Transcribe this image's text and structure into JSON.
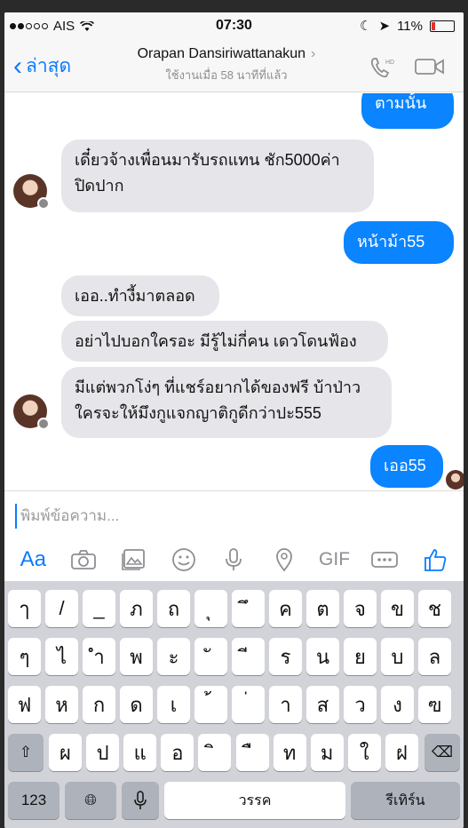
{
  "status": {
    "carrier": "AIS",
    "time": "07:30",
    "battery": "11%",
    "signal_icon": "signal-dots",
    "wifi_icon": "wifi-icon"
  },
  "nav": {
    "back_label": "ล่าสุด",
    "contact_name": "Orapan Dansiriwattanakun",
    "active_status": "ใช้งานเมื่อ 58 นาทีที่แล้ว",
    "call_icon": "phone-hd-icon",
    "video_icon": "video-camera-icon"
  },
  "messages": [
    {
      "direction": "out",
      "text": "ตามนั้น"
    },
    {
      "direction": "in",
      "text": "เดี๋ยวจ้างเพื่อนมารับรถแทน ชัก5000ค่าปิดปาก"
    },
    {
      "direction": "out",
      "text": "หน้าม้า55"
    },
    {
      "direction": "in",
      "text": "เออ..ทำงี้มาตลอด"
    },
    {
      "direction": "in",
      "text": "อย่าไปบอกใครอะ มีรู้ไม่กี่คน เดวโดนฟ้อง"
    },
    {
      "direction": "in",
      "text": "มีแต่พวกโง่ๆ ที่แชร์อยากได้ของฟรี บ้าป่าวใครจะให้มึงกูแจกญาติกูดีกว่าปะ555"
    },
    {
      "direction": "out",
      "text": "เออ55"
    }
  ],
  "composer": {
    "placeholder": "พิมพ์ข้อความ...",
    "value": ""
  },
  "toolbar": {
    "aa_label": "Aa",
    "gif_label": "GIF",
    "icons": [
      "text-format-icon",
      "camera-icon",
      "photo-gallery-icon",
      "emoji-icon",
      "microphone-icon",
      "location-icon",
      "gif-icon",
      "more-icon",
      "like-thumb-icon"
    ]
  },
  "keyboard": {
    "row1": [
      "ๅ",
      "/",
      "_",
      "ภ",
      "ถ",
      "ุ",
      "ึ",
      "ค",
      "ต",
      "จ",
      "ข",
      "ช"
    ],
    "row2": [
      "ๆ",
      "ไ",
      "ำ",
      "พ",
      "ะ",
      "ั",
      "ี",
      "ร",
      "น",
      "ย",
      "บ",
      "ล"
    ],
    "row3": [
      "ฟ",
      "ห",
      "ก",
      "ด",
      "เ",
      "้",
      "่",
      "า",
      "ส",
      "ว",
      "ง",
      "ฃ"
    ],
    "row4": [
      "ผ",
      "ป",
      "แ",
      "อ",
      "ิ",
      "ื",
      "ท",
      "ม",
      "ใ",
      "ฝ"
    ],
    "numbers_label": "123",
    "space_label": "วรรค",
    "return_label": "รีเทิร์น",
    "shift_icon": "shift-icon",
    "delete_icon": "delete-icon",
    "globe_icon": "globe-icon",
    "mic_icon": "keyboard-mic-icon"
  },
  "colors": {
    "accent": "#0a84ff",
    "incoming_bubble": "#e6e6ea",
    "keyboard_bg": "#d1d3d9"
  }
}
